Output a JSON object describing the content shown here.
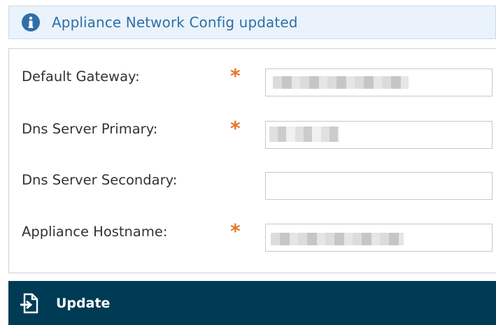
{
  "notice": {
    "icon": "info-circle-icon",
    "message": "Appliance Network Config updated"
  },
  "form": {
    "fields": [
      {
        "label": "Default Gateway:",
        "required": true,
        "required_mark": "*",
        "value": ""
      },
      {
        "label": "Dns Server Primary:",
        "required": true,
        "required_mark": "*",
        "value": ""
      },
      {
        "label": "Dns Server Secondary:",
        "required": false,
        "value": ""
      },
      {
        "label": "Appliance Hostname:",
        "required": true,
        "required_mark": "*",
        "value": ""
      }
    ]
  },
  "actions": {
    "update_label": "Update",
    "update_icon": "document-arrow-icon"
  },
  "colors": {
    "notice_background": "#eaf3fb",
    "notice_text": "#2f6fa8",
    "required": "#e8752a",
    "action_bar": "#003b55"
  }
}
